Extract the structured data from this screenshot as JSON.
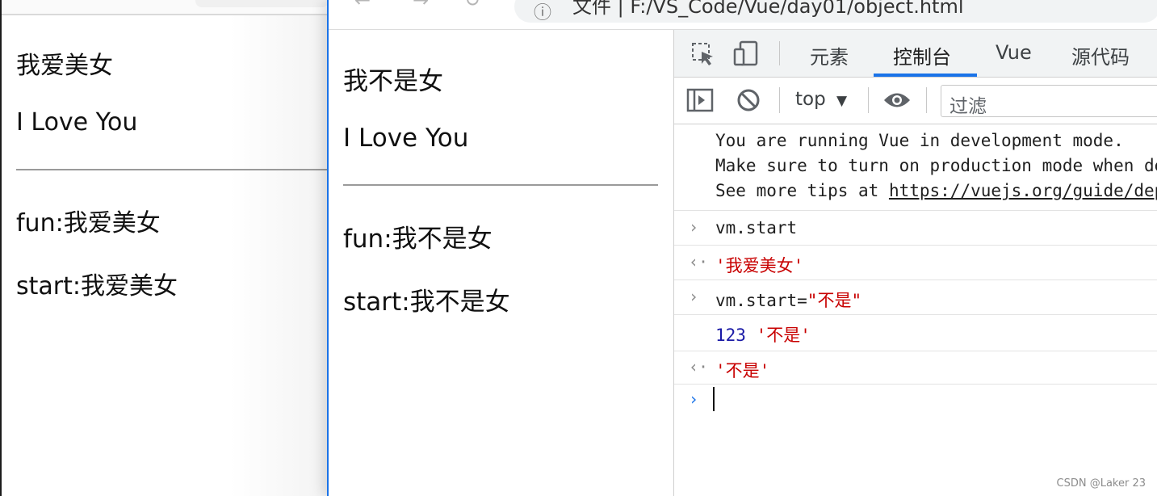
{
  "back_window": {
    "lines": [
      "我爱美女",
      "I Love You",
      "fun:我爱美女",
      "start:我爱美女"
    ]
  },
  "front_window": {
    "address_bar": {
      "url": "文件 | F:/VS_Code/Vue/day01/object.html"
    },
    "lines": [
      "我不是女",
      "I Love You",
      "fun:我不是女",
      "start:我不是女"
    ]
  },
  "devtools": {
    "tabs": [
      {
        "label": "元素",
        "active": false
      },
      {
        "label": "控制台",
        "active": true
      },
      {
        "label": "Vue",
        "active": false
      },
      {
        "label": "源代码",
        "active": false
      }
    ],
    "toolbar": {
      "context": "top",
      "filter_placeholder": "过滤"
    },
    "console": {
      "warning": [
        "You are running Vue in development mode.",
        "Make sure to turn on production mode when deploying for production.",
        "See more tips at "
      ],
      "warning_link": "https://vuejs.org/guide/deployment.html",
      "entries": [
        {
          "kind": "input",
          "text": "vm.start"
        },
        {
          "kind": "result",
          "text": "'我爱美女'"
        },
        {
          "kind": "input",
          "text_code": "vm.start=",
          "text_str": "\"不是\""
        },
        {
          "kind": "log",
          "num": "123",
          "str": "'不是'"
        },
        {
          "kind": "result",
          "text": "'不是'"
        }
      ]
    }
  },
  "colors": {
    "accent": "#1a73e8",
    "string": "#c80000",
    "number": "#1a1aa6"
  },
  "watermark": "CSDN @Laker 23"
}
